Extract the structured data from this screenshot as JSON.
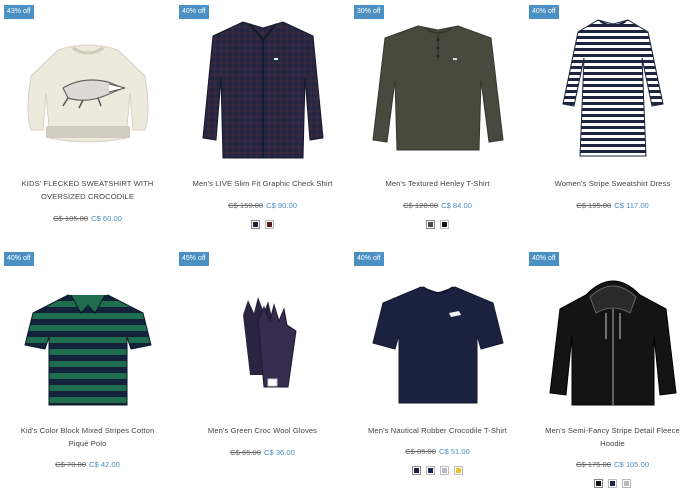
{
  "products": [
    {
      "badge": "43% off",
      "name_line1": "KIDS' FLECKED SWEATSHIRT WITH",
      "name_line2": "OVERSIZED CROCODILE",
      "old_price": "C$ 105.00",
      "new_price": "C$ 60.00",
      "swatches": [],
      "image_icon": "sweatshirt-crocodile-icon"
    },
    {
      "badge": "40% off",
      "name_line1": "Men's LIVE Slim Fit Graphic Check Shirt",
      "name_line2": "",
      "old_price": "C$ 150.00",
      "new_price": "C$ 90.00",
      "swatches": [
        "#1e2235",
        "#5b1f22"
      ],
      "image_icon": "check-shirt-icon"
    },
    {
      "badge": "30% off",
      "name_line1": "Men's Textured Henley T-Shirt",
      "name_line2": "",
      "old_price": "C$ 120.00",
      "new_price": "C$ 84.00",
      "swatches": [
        "#4b4c46",
        "#111111"
      ],
      "image_icon": "henley-shirt-icon"
    },
    {
      "badge": "40% off",
      "name_line1": "Women's Stripe Sweatshirt Dress",
      "name_line2": "",
      "old_price": "C$ 195.00",
      "new_price": "C$ 117.00",
      "swatches": [],
      "image_icon": "stripe-dress-icon"
    },
    {
      "badge": "40% off",
      "name_line1": "Kid's Color Block Mixed Stripes Cotton",
      "name_line2": "Piqué Polo",
      "old_price": "C$ 70.00",
      "new_price": "C$ 42.00",
      "swatches": [],
      "image_icon": "striped-polo-icon"
    },
    {
      "badge": "45% off",
      "name_line1": "Men's Green Croc Wool Gloves",
      "name_line2": "",
      "old_price": "C$ 65.00",
      "new_price": "C$ 36.00",
      "swatches": [],
      "image_icon": "gloves-icon"
    },
    {
      "badge": "40% off",
      "name_line1": "Men's Nautical Rubber Crocodile T-Shirt",
      "name_line2": "",
      "old_price": "C$ 85.00",
      "new_price": "C$ 51.00",
      "swatches": [
        "#1a2440",
        "#162a55",
        "#b8bcbe",
        "#e2c630"
      ],
      "image_icon": "tshirt-icon"
    },
    {
      "badge": "40% off",
      "name_line1": "Men's Semi-Fancy Stripe Detail Fleece",
      "name_line2": "Hoodie",
      "old_price": "C$ 175.00",
      "new_price": "C$ 105.00",
      "swatches": [
        "#111111",
        "#1a2440",
        "#b8bcbe"
      ],
      "image_icon": "hoodie-icon"
    }
  ]
}
